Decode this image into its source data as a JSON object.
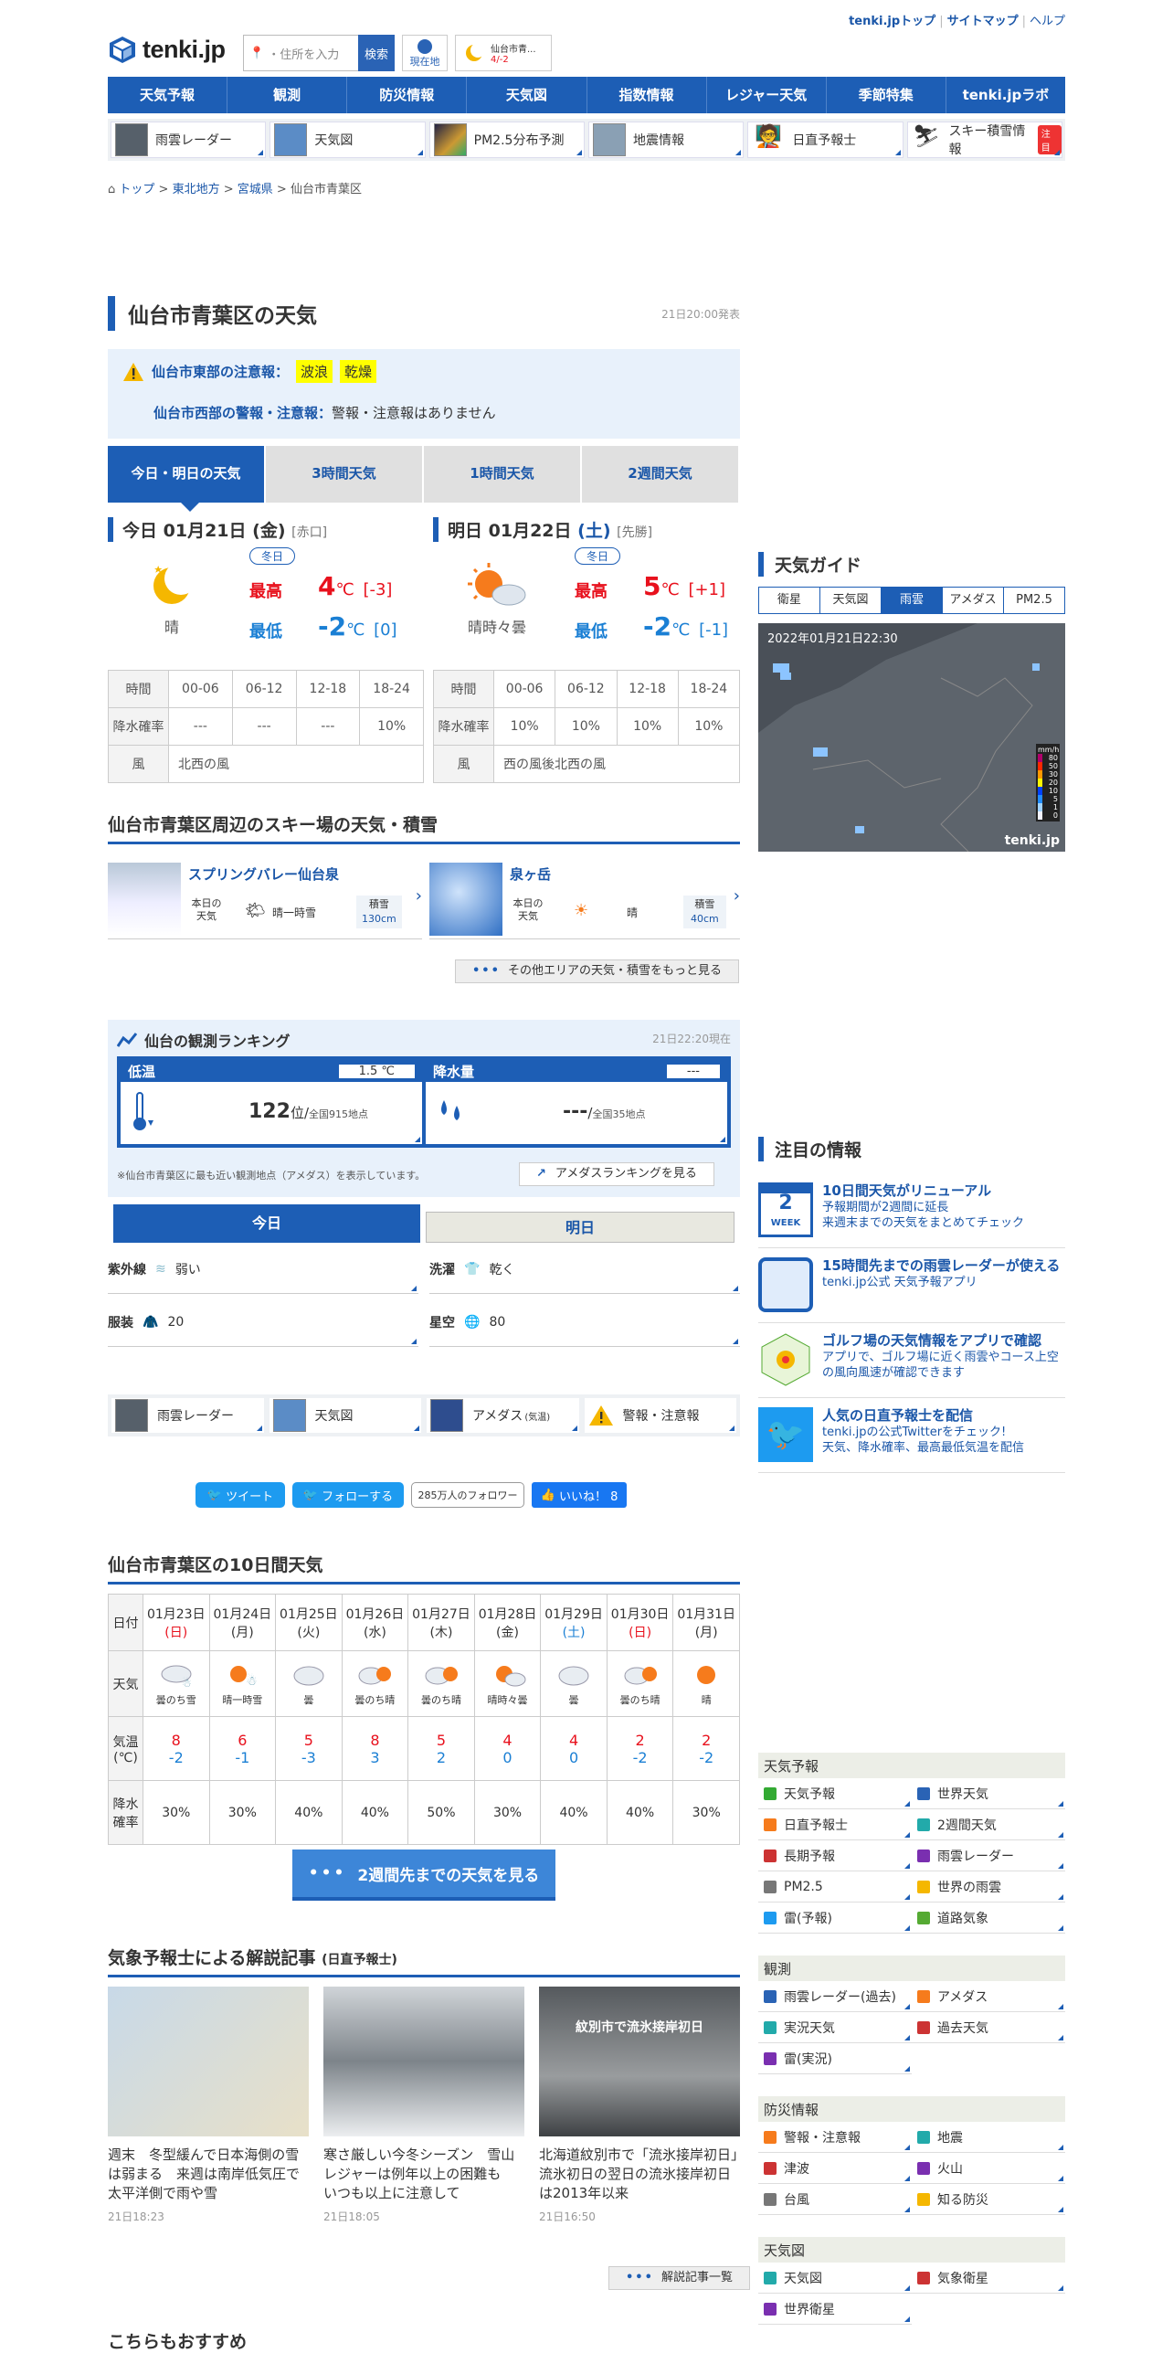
{
  "header": {
    "top_links": [
      "tenki.jpトップ",
      "サイトマップ",
      "ヘルプ"
    ],
    "logo": "tenki.jp",
    "search_placeholder": "・住所を入力",
    "search_button": "検索",
    "location_button": "現在地",
    "mini_city": "仙台市青...",
    "mini_temp": "4/-2"
  },
  "nav": [
    "天気予報",
    "観測",
    "防災情報",
    "天気図",
    "指数情報",
    "レジャー天気",
    "季節特集",
    "tenki.jpラボ"
  ],
  "subnav": [
    {
      "label": "雨雲レーダー"
    },
    {
      "label": "天気図"
    },
    {
      "label": "PM2.5分布予測"
    },
    {
      "label": "地震情報"
    },
    {
      "label": "日直予報士"
    },
    {
      "label": "スキー積雪情報",
      "badge": "注目"
    }
  ],
  "breadcrumb": [
    "トップ",
    "東北地方",
    "宮城県",
    "仙台市青葉区"
  ],
  "page": {
    "title": "仙台市青葉区の天気",
    "published": "21日20:00発表"
  },
  "warnings": {
    "east_label": "仙台市東部の注意報：",
    "east_items": [
      "波浪",
      "乾燥"
    ],
    "west_label": "仙台市西部の警報・注意報：",
    "west_text": "警報・注意報はありません"
  },
  "forecast_tabs": [
    "今日・明日の天気",
    "3時間天気",
    "1時間天気",
    "2週間天気"
  ],
  "today": {
    "label": "今日",
    "date": "01月21日",
    "dow": "(金)",
    "rokuyo": "[赤口]",
    "season": "冬日",
    "weather": "晴",
    "high_label": "最高",
    "high": "4",
    "high_diff": "[-3]",
    "low_label": "最低",
    "low": "-2",
    "low_diff": "[0]",
    "unit": "℃",
    "rows": {
      "time_label": "時間",
      "times": [
        "00-06",
        "06-12",
        "12-18",
        "18-24"
      ],
      "rain_label": "降水確率",
      "rain": [
        "---",
        "---",
        "---",
        "10%"
      ],
      "wind_label": "風",
      "wind": "北西の風"
    }
  },
  "tomorrow": {
    "label": "明日",
    "date": "01月22日",
    "dow": "(土)",
    "rokuyo": "[先勝]",
    "season": "冬日",
    "weather": "晴時々曇",
    "high_label": "最高",
    "high": "5",
    "high_diff": "[+1]",
    "low_label": "最低",
    "low": "-2",
    "low_diff": "[-1]",
    "unit": "℃",
    "rows": {
      "time_label": "時間",
      "times": [
        "00-06",
        "06-12",
        "12-18",
        "18-24"
      ],
      "rain_label": "降水確率",
      "rain": [
        "10%",
        "10%",
        "10%",
        "10%"
      ],
      "wind_label": "風",
      "wind": "西の風後北西の風"
    }
  },
  "ski": {
    "title": "仙台市青葉区周辺のスキー場の天気・積雪",
    "resorts": [
      {
        "name": "スプリングバレー仙台泉",
        "day_label": "本日の天気",
        "weather": "晴一時雪",
        "snow_label": "積雪",
        "snow": "130cm"
      },
      {
        "name": "泉ヶ岳",
        "day_label": "本日の天気",
        "weather": "晴",
        "snow_label": "積雪",
        "snow": "40cm"
      }
    ],
    "more": "その他エリアの天気・積雪をもっと見る"
  },
  "ranking": {
    "title": "仙台の観測ランキング",
    "time": "21日22:20現在",
    "temp_label": "低温",
    "temp_value": "1.5 ℃",
    "temp_rank": "122",
    "temp_rank_unit": "位/",
    "temp_total": "全国915地点",
    "rain_label": "降水量",
    "rain_value": "---",
    "rain_rank": "---",
    "rain_rank_unit": "/",
    "rain_total": "全国35地点",
    "note": "※仙台市青葉区に最も近い観測地点（アメダス）を表示しています。",
    "link": "アメダスランキングを見る"
  },
  "index_tabs": [
    "今日",
    "明日"
  ],
  "indices": [
    {
      "label": "紫外線",
      "value": "弱い"
    },
    {
      "label": "洗濯",
      "value": "乾く"
    },
    {
      "label": "服装",
      "value": "20"
    },
    {
      "label": "星空",
      "value": "80"
    }
  ],
  "links4": [
    "雨雲レーダー",
    "天気図",
    "アメダス",
    "(気温)",
    "警報・注意報"
  ],
  "social": {
    "tweet": "ツイート",
    "follow": "フォローする",
    "followers": "285万人のフォロワー",
    "like": "いいね！ 8"
  },
  "tenday": {
    "title": "仙台市青葉区の10日間天気",
    "date_label": "日付",
    "weather_label": "天気",
    "temp_label": "気温(℃)",
    "rain_label": "降水確率",
    "days": [
      {
        "date": "01月23日",
        "dow": "(日)",
        "dowc": "sun",
        "w": "曇のち雪",
        "hi": "8",
        "lo": "-2",
        "rain": "30%",
        "icon": "cloud-snow"
      },
      {
        "date": "01月24日",
        "dow": "(月)",
        "dowc": "",
        "w": "晴一時雪",
        "hi": "6",
        "lo": "-1",
        "rain": "30%",
        "icon": "sun-snow"
      },
      {
        "date": "01月25日",
        "dow": "(火)",
        "dowc": "",
        "w": "曇",
        "hi": "5",
        "lo": "-3",
        "rain": "40%",
        "icon": "cloud"
      },
      {
        "date": "01月26日",
        "dow": "(水)",
        "dowc": "",
        "w": "曇のち晴",
        "hi": "8",
        "lo": "3",
        "rain": "40%",
        "icon": "cloud-sun"
      },
      {
        "date": "01月27日",
        "dow": "(木)",
        "dowc": "",
        "w": "曇のち晴",
        "hi": "5",
        "lo": "2",
        "rain": "50%",
        "icon": "cloud-sun"
      },
      {
        "date": "01月28日",
        "dow": "(金)",
        "dowc": "",
        "w": "晴時々曇",
        "hi": "4",
        "lo": "0",
        "rain": "30%",
        "icon": "sun-cloud"
      },
      {
        "date": "01月29日",
        "dow": "(土)",
        "dowc": "sat",
        "w": "曇",
        "hi": "4",
        "lo": "0",
        "rain": "40%",
        "icon": "cloud"
      },
      {
        "date": "01月30日",
        "dow": "(日)",
        "dowc": "sun",
        "w": "曇のち晴",
        "hi": "2",
        "lo": "-2",
        "rain": "40%",
        "icon": "cloud-sun"
      },
      {
        "date": "01月31日",
        "dow": "(月)",
        "dowc": "",
        "w": "晴",
        "hi": "2",
        "lo": "-2",
        "rain": "30%",
        "icon": "sun"
      }
    ],
    "more_button": "2週間先までの天気を見る"
  },
  "articles": {
    "title": "気象予報士による解説記事",
    "subtitle": "(日直予報士)",
    "items": [
      {
        "text": "週末　冬型緩んで日本海側の雪は弱まる　来週は南岸低気圧で太平洋側で雨や雪",
        "date": "21日18:23"
      },
      {
        "text": "寒さ厳しい今冬シーズン　雪山レジャーは例年以上の困難も　いつも以上に注意して",
        "date": "21日18:05"
      },
      {
        "text": "北海道紋別市で「流氷接岸初日」　流氷初日の翌日の流氷接岸初日は2013年以来",
        "date": "21日16:50"
      }
    ],
    "img_caption": "紋別市で流氷接岸初日",
    "more": "解説記事一覧"
  },
  "recommend_title": "こちらもおすすめ",
  "sidebar": {
    "guide_title": "天気ガイド",
    "guide_tabs": [
      "衛星",
      "天気図",
      "雨雲",
      "アメダス",
      "PM2.5"
    ],
    "radar_time": "2022年01月21日22:30",
    "radar_logo": "tenki.jp",
    "radar_legend_unit": "mm/h",
    "radar_legend": [
      "80",
      "50",
      "30",
      "20",
      "10",
      "5",
      "1",
      "0"
    ],
    "news_title": "注目の情報",
    "news": [
      {
        "title": "10日間天気がリニューアル",
        "desc": "予報期間が2週間に延長\n来週末までの天気をまとめてチェック",
        "icon_text": "2",
        "icon_sub": "WEEK"
      },
      {
        "title": "15時間先までの雨雲レーダーが使える",
        "desc": "tenki.jp公式 天気予報アプリ"
      },
      {
        "title": "ゴルフ場の天気情報をアプリで確認",
        "desc": "アプリで、ゴルフ場に近く雨雲やコース上空の風向風速が確認できます"
      },
      {
        "title": "人気の日直予報士を配信",
        "desc": "tenki.jpの公式Twitterをチェック!\n天気、降水確率、最高最低気温を配信"
      }
    ],
    "groups": [
      {
        "title": "天気予報",
        "items": [
          "天気予報",
          "世界天気",
          "日直予報士",
          "2週間天気",
          "長期予報",
          "雨雲レーダー",
          "PM2.5",
          "世界の雨雲",
          "雷(予報)",
          "道路気象"
        ]
      },
      {
        "title": "観測",
        "items": [
          "雨雲レーダー(過去)",
          "アメダス",
          "実況天気",
          "過去天気",
          "雷(実況)"
        ]
      },
      {
        "title": "防災情報",
        "items": [
          "警報・注意報",
          "地震",
          "津波",
          "火山",
          "台風",
          "知る防災"
        ]
      },
      {
        "title": "天気図",
        "items": [
          "天気図",
          "気象衛星",
          "世界衛星"
        ]
      }
    ]
  }
}
